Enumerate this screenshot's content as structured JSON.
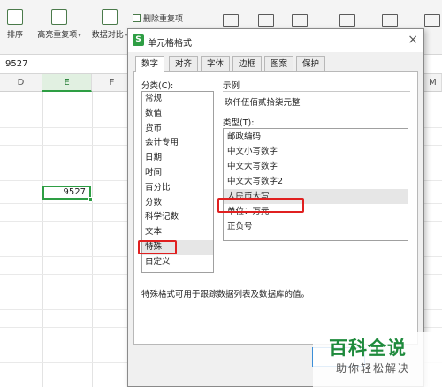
{
  "ribbon": {
    "sort_label": "排序",
    "highlight_dup_label": "高亮重复项",
    "data_compare_label": "数据对比",
    "delete_dup_label": "删除重复项"
  },
  "formula_bar": {
    "value": "9527"
  },
  "grid": {
    "columns": [
      "D",
      "E",
      "F",
      "M"
    ],
    "active_cell_value": "9527"
  },
  "dialog": {
    "title": "单元格格式",
    "close_glyph": "×",
    "tabs": [
      "数字",
      "对齐",
      "字体",
      "边框",
      "图案",
      "保护"
    ],
    "category_label": "分类(C):",
    "categories": [
      "常规",
      "数值",
      "货币",
      "会计专用",
      "日期",
      "时间",
      "百分比",
      "分数",
      "科学记数",
      "文本",
      "特殊",
      "自定义"
    ],
    "selected_category": "特殊",
    "sample_label": "示例",
    "sample_value": "玖仟伍佰贰拾柒元整",
    "type_label": "类型(T):",
    "types": [
      "邮政编码",
      "中文小写数字",
      "中文大写数字",
      "中文大写数字2",
      "人民币大写",
      "单位：万元",
      "正负号"
    ],
    "selected_type": "人民币大写",
    "description": "特殊格式可用于跟踪数据列表及数据库的值。"
  },
  "watermark": {
    "main": "百科全说",
    "sub": "助你轻松解决"
  },
  "colors": {
    "accent": "#2e9e44",
    "highlight_box": "#e02020",
    "watermark": "#1e8a3c"
  }
}
